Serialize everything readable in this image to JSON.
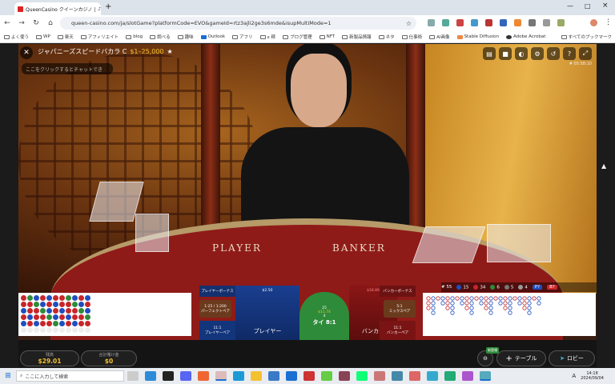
{
  "browser": {
    "tab_title": "QueenCasino クイーンカジノ | ",
    "url": "queen-casino.com/ja/slotGame?platformCode=EVO&gameId=rtz3ajli2ge3s6mde&isupMultiMode=1",
    "bookmarks": [
      "よく使う",
      "WP",
      "楽天",
      "アフィリエイト",
      "blog",
      "調べる",
      "趣味",
      "Outlook",
      "アフリ",
      "x 稼",
      "ブログ管理",
      "NFT",
      "新製品情報",
      "ネタ",
      "仕事術",
      "AI画像",
      "Stable Diffusion",
      "Adobe Acrobat"
    ],
    "all_bookmarks": "すべてのブックマーク"
  },
  "game": {
    "title": "ジャパニーズスピードバカラ C",
    "limits": "$1–25,000",
    "chat_placeholder": "ここをクリックするとチャットでき",
    "round_id": "# 05:58:10",
    "felt_player": "PLAYER",
    "felt_banker": "BANKER",
    "stats": {
      "total": "# 55",
      "player": "15",
      "banker": "34",
      "tie": "6",
      "pp": "5",
      "bp": "4",
      "p_label": "P?",
      "b_label": "B?"
    },
    "bets": {
      "player_bonus": "プレイヤーボーナス",
      "banker_bonus": "バンカーボーナス",
      "perfect_pair": "パーフェクトペア",
      "perfect_pair_odds": "1:25 / 1:200",
      "mixed_pair": "ミックスペア",
      "mixed_pair_odds": "5:1",
      "player_pair": "プレイヤーペア",
      "player_pair_odds": "11:1",
      "banker_pair": "バンカーペア",
      "banker_pair_odds": "11:1",
      "player": "プレイヤー",
      "player_amount": "$2.50",
      "tie": "タイ 8:1",
      "tie_amount": "$11.74",
      "tie_count": "4",
      "tie_top": "25",
      "banker": "バンカー",
      "banker_amount": "$18.89"
    },
    "balance_label": "残高",
    "balance_value": "$29.01",
    "total_bet_label": "合計賭け金",
    "total_bet_value": "$0",
    "new_badge": "新登場",
    "table_button": "テーブル",
    "lobby_button": "ロビー"
  },
  "taskbar": {
    "search_placeholder": "ここに入力して検索",
    "time": "14:18",
    "date": "2024/09/04",
    "ime": "A"
  },
  "colors": {
    "player": "#1f4fbf",
    "banker": "#c8262a",
    "tie": "#2e8b3a",
    "accent": "#f2c230"
  },
  "icons": [
    "close-icon",
    "star-icon",
    "video-icon",
    "camera-icon",
    "volume-icon",
    "settings-icon",
    "help-icon",
    "history-icon",
    "fullscreen-icon",
    "chips-icon",
    "plus-icon",
    "lobby-arrow-icon"
  ]
}
